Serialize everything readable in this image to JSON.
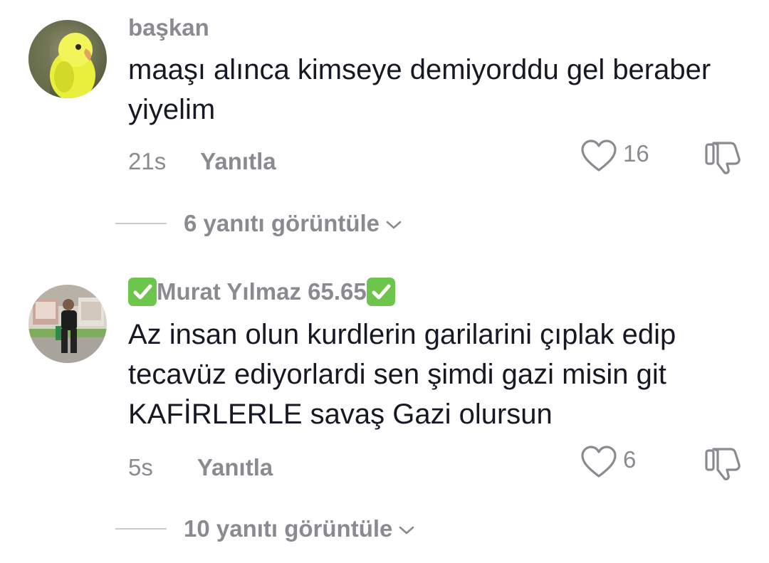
{
  "comments": [
    {
      "username": "başkan",
      "text": "maaşı alınca kimseye demiyorddu gel beraber yiyelim",
      "time": "21s",
      "reply_label": "Yanıtla",
      "like_count": "16",
      "view_replies_label": "6 yanıtı görüntüle",
      "avatar_icon": "yellow-parakeet-avatar"
    },
    {
      "username_main": "Murat Yılmaz 65.65",
      "username_prefix_emoji": "check-mark-button-icon",
      "username_suffix_emoji": "check-mark-button-icon",
      "text": "Az insan olun kurdlerin garilarini çıplak edip tecavüz ediyorlardi sen şimdi gazi misin git KAFİRLERLE savaş Gazi olursun",
      "time": "5s",
      "reply_label": "Yanıtla",
      "like_count": "6",
      "view_replies_label": "10 yanıtı görüntüle",
      "avatar_icon": "man-storefront-photo-avatar"
    }
  ],
  "colors": {
    "text_primary": "#161823",
    "text_secondary": "#8a8b91",
    "divider": "#c9cacd",
    "check_green": "#6dc54b"
  }
}
